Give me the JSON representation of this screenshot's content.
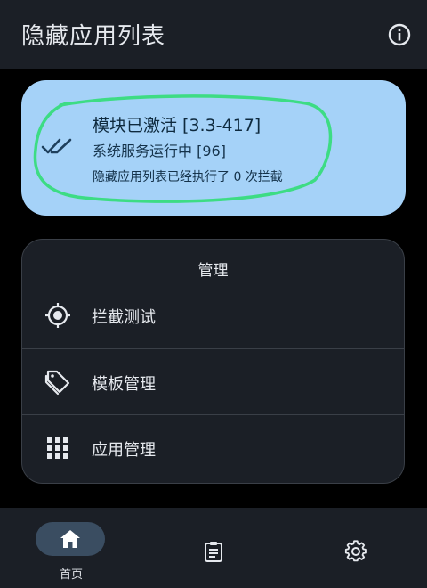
{
  "app": {
    "title": "隐藏应用列表",
    "info_icon": "info-icon"
  },
  "status_card": {
    "title": "模块已激活 [3.3-417]",
    "service": "系统服务运行中 [96]",
    "intercepts": "隐藏应用列表已经执行了 0 次拦截",
    "icon": "double-check-icon",
    "background_color": "#a5d2f8",
    "highlight_color": "#3ddc84"
  },
  "manage_card": {
    "title": "管理",
    "items": [
      {
        "label": "拦截测试",
        "icon": "crosshair-icon"
      },
      {
        "label": "模板管理",
        "icon": "tag-icon"
      },
      {
        "label": "应用管理",
        "icon": "apps-grid-icon"
      }
    ]
  },
  "bottom_nav": {
    "items": [
      {
        "label": "首页",
        "icon": "home-icon",
        "selected": true
      },
      {
        "label": "",
        "icon": "clipboard-icon",
        "selected": false
      },
      {
        "label": "",
        "icon": "gear-icon",
        "selected": false
      }
    ],
    "selected_color": "#3a4d61"
  }
}
